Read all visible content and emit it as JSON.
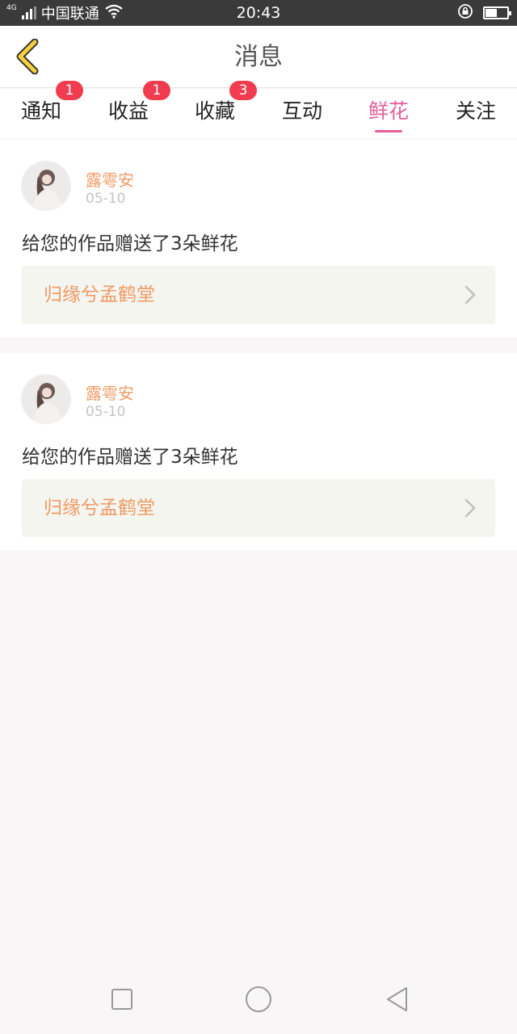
{
  "status_bar": {
    "network_type": "4G",
    "carrier": "中国联通",
    "time": "20:43",
    "battery_level": 0.55,
    "icons": [
      "signal-icon",
      "wifi-icon",
      "rotation-lock-icon",
      "battery-icon"
    ]
  },
  "header": {
    "title": "消息",
    "back_icon": "chevron-left-icon",
    "back_color": "#f5d23c"
  },
  "tabs": [
    {
      "label": "通知",
      "badge": "1"
    },
    {
      "label": "收益",
      "badge": "1"
    },
    {
      "label": "收藏",
      "badge": "3"
    },
    {
      "label": "互动",
      "badge": ""
    },
    {
      "label": "鲜花",
      "badge": "",
      "active": true
    },
    {
      "label": "关注",
      "badge": ""
    }
  ],
  "messages": [
    {
      "user": "露雩安",
      "date": "05-10",
      "text": "给您的作品赠送了3朵鲜花",
      "work_title": "归缘兮孟鹤堂"
    },
    {
      "user": "露雩安",
      "date": "05-10",
      "text": "给您的作品赠送了3朵鲜花",
      "work_title": "归缘兮孟鹤堂"
    }
  ],
  "nav_bar": {
    "icons": [
      "recent-apps-icon",
      "home-icon",
      "back-icon"
    ]
  },
  "colors": {
    "accent": "#e85d9c",
    "username": "#ef9a65",
    "badge": "#f13c4f"
  }
}
